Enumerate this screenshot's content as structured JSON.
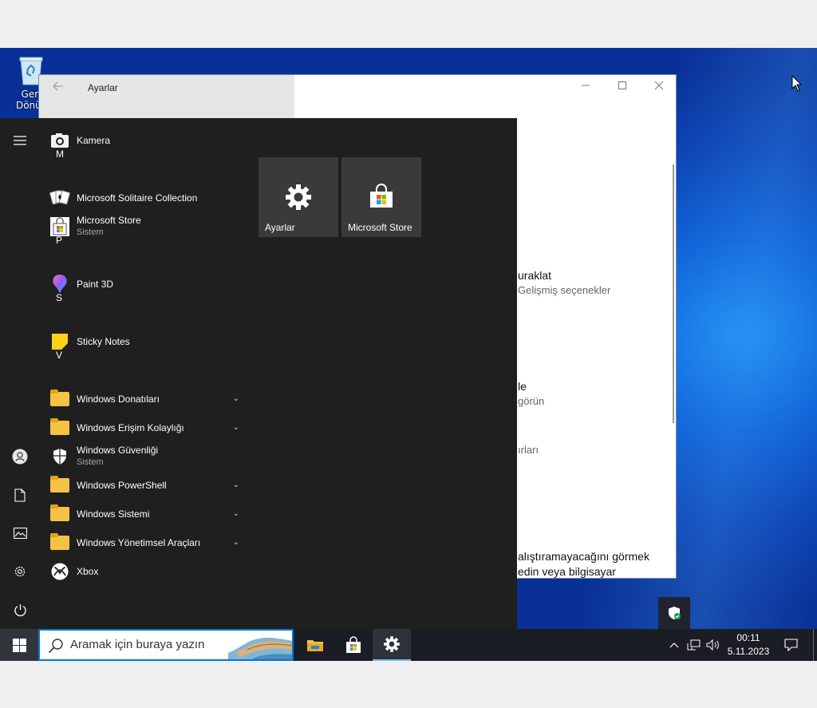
{
  "desktop": {
    "recycle_bin_label_line1": "Geri",
    "recycle_bin_label_line2": "Dönüş"
  },
  "settings_window": {
    "title": "Ayarlar",
    "fragments": [
      {
        "text": "uraklat",
        "kind": "big"
      },
      {
        "text": "Gelişmiş seçenekler",
        "kind": "sm"
      },
      {
        "text": "le",
        "kind": "big"
      },
      {
        "text": "görün",
        "kind": "sm"
      },
      {
        "text": "ırları",
        "kind": "sm"
      },
      {
        "text": "alıştıramayacağını görmek",
        "kind": "big"
      },
      {
        "text": "edin veya bilgisayar",
        "kind": "big"
      }
    ]
  },
  "start_menu": {
    "letters": {
      "m": "M",
      "p": "P",
      "s": "S",
      "v": "V"
    },
    "apps": {
      "kamera": "Kamera",
      "solitaire": "Microsoft Solitaire Collection",
      "store": "Microsoft Store",
      "store_sub": "Sistem",
      "paint3d": "Paint 3D",
      "sticky": "Sticky Notes",
      "accessories": "Windows Donatıları",
      "ease": "Windows Erişim Kolaylığı",
      "security": "Windows Güvenliği",
      "security_sub": "Sistem",
      "powershell": "Windows PowerShell",
      "system": "Windows Sistemi",
      "admin": "Windows Yönetimsel Araçları",
      "xbox": "Xbox"
    },
    "tiles": {
      "settings": "Ayarlar",
      "store": "Microsoft Store"
    }
  },
  "taskbar": {
    "search_placeholder": "Aramak için buraya yazın",
    "time": "00:11",
    "date": "5.11.2023"
  },
  "colors": {
    "accent": "#0078d7",
    "start_bg": "#1f1f1f",
    "tile_bg": "#3a3a3a",
    "taskbar_bg": "#1b1d24",
    "folder": "#f5c344"
  }
}
